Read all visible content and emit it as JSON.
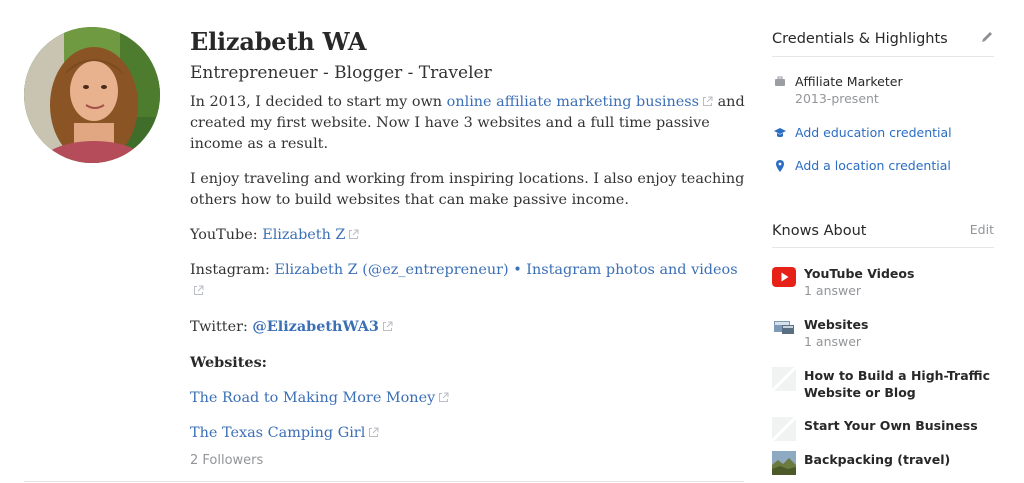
{
  "profile": {
    "name": "Elizabeth WA",
    "tagline": "Entrepreneuer - Blogger - Traveler",
    "bio": {
      "p1_before": "In 2013, I decided to start my own ",
      "p1_link": "online affiliate marketing business",
      "p1_after": " and created my first website. Now I have 3 websites and a full time passive income as a result.",
      "p2": "I enjoy traveling and working from inspiring locations. I also enjoy teaching others how to build websites that can make passive income.",
      "youtube_label": "YouTube: ",
      "youtube_link": "Elizabeth Z",
      "instagram_label": "Instagram: ",
      "instagram_link": "Elizabeth Z (@ez_entrepreneur) • Instagram photos and videos",
      "twitter_label": "Twitter: ",
      "twitter_link": "@ElizabethWA3",
      "websites_heading": "Websites:",
      "site1": "The Road to Making More Money",
      "site2": "The Texas Camping Girl"
    },
    "followers": "2 Followers"
  },
  "sidebar": {
    "credentials": {
      "title": "Credentials & Highlights",
      "items": [
        {
          "label": "Affiliate Marketer",
          "sub": "2013-present",
          "icon": "briefcase-icon"
        },
        {
          "label": "Add education credential",
          "icon": "graduation-cap-icon"
        },
        {
          "label": "Add a location credential",
          "icon": "location-pin-icon"
        }
      ]
    },
    "knows_about": {
      "title": "Knows About",
      "edit_label": "Edit",
      "topics": [
        {
          "name": "YouTube Videos",
          "answers": "1 answer",
          "icon": "youtube-icon"
        },
        {
          "name": "Websites",
          "answers": "1 answer",
          "icon": "websites-icon"
        },
        {
          "name_line1": "How to Build a High-Traffic",
          "name_line2": "Website or Blog",
          "icon": "placeholder-icon"
        },
        {
          "name": "Start Your Own Business",
          "icon": "placeholder-icon"
        },
        {
          "name": "Backpacking (travel)",
          "icon": "landscape-icon"
        }
      ]
    }
  },
  "colors": {
    "link": "#3b6fb6",
    "muted": "#939598",
    "youtube_red": "#e62117"
  }
}
